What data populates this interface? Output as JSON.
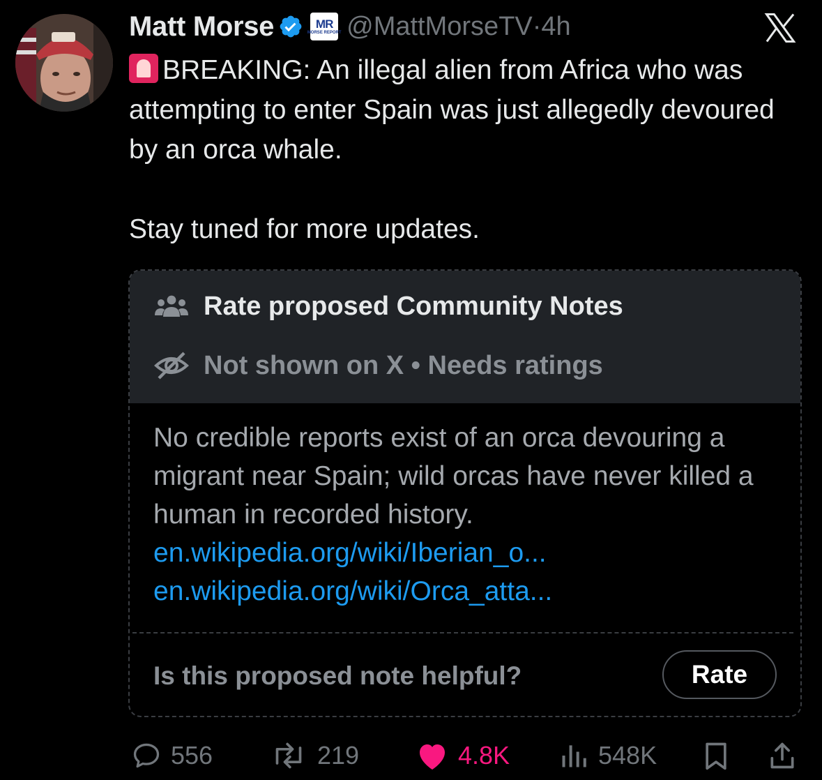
{
  "tweet": {
    "author_name": "Matt Morse",
    "org_badge": {
      "line1": "MR",
      "line2": "MORSE REPORT"
    },
    "handle": "@MattMorseTV",
    "separator": "·",
    "time": "4h",
    "text_main": "BREAKING: An illegal alien from Africa who was attempting to enter Spain was just allegedly devoured by an orca whale.",
    "text_followup": "Stay tuned for more updates."
  },
  "community_note": {
    "title": "Rate proposed Community Notes",
    "status": "Not shown on X • Needs ratings",
    "body": "No credible reports exist of an orca devouring a migrant near Spain; wild orcas have never killed a human in recorded history.",
    "links": [
      "en.wikipedia.org/wiki/Iberian_o...",
      "en.wikipedia.org/wiki/Orca_atta..."
    ],
    "helpful_question": "Is this proposed note helpful?",
    "rate_label": "Rate"
  },
  "actions": {
    "replies": "556",
    "reposts": "219",
    "likes": "4.8K",
    "views": "548K"
  },
  "colors": {
    "background": "#000000",
    "text": "#e7e9ea",
    "muted": "#71767b",
    "link": "#1d9bf0",
    "like": "#f91880",
    "verified": "#1d9bf0"
  },
  "icons": [
    "verified-badge-icon",
    "x-logo-icon",
    "siren-icon",
    "people-icon",
    "eye-off-icon",
    "reply-icon",
    "repost-icon",
    "heart-icon",
    "views-icon",
    "bookmark-icon",
    "share-icon"
  ]
}
